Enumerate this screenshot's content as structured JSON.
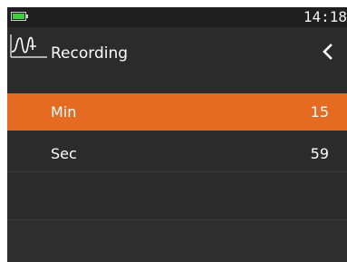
{
  "status_bar": {
    "time": "14:18",
    "battery_icon": "battery-icon"
  },
  "header": {
    "title": "Recording",
    "icon": "waveform-icon",
    "back_icon": "chevron-left-icon"
  },
  "rows": [
    {
      "label": "Min",
      "value": "15",
      "selected": true
    },
    {
      "label": "Sec",
      "value": "59",
      "selected": false
    }
  ],
  "colors": {
    "accent": "#e56a22",
    "background": "#2b2b2b",
    "battery": "#3ed13e"
  }
}
